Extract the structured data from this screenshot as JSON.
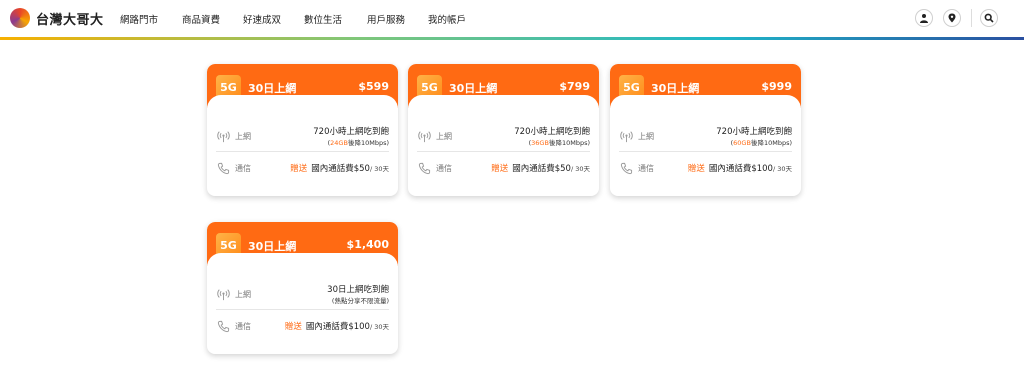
{
  "brand": {
    "name": "台灣大哥大"
  },
  "nav": {
    "items": [
      "網路門市",
      "商品資費",
      "好速成双",
      "數位生活",
      "用戶服務",
      "我的帳戶"
    ]
  },
  "header_icons": [
    "user-icon",
    "location-pin-icon",
    "search-icon"
  ],
  "colors": {
    "accent": "#ff6a13",
    "badge": "#ff9a2e"
  },
  "plans": [
    {
      "badge": "5G",
      "title": "30日上網",
      "price": "$599",
      "data_label": "上網",
      "data_main": "720小時上網吃到飽",
      "data_sub_prefix": "(",
      "data_sub_highlight": "24GB",
      "data_sub_suffix": "後降10Mbps)",
      "call_label": "通信",
      "call_gift": "贈送",
      "call_text": "國內通話費$50",
      "call_per": "/ 30天"
    },
    {
      "badge": "5G",
      "title": "30日上網",
      "price": "$799",
      "data_label": "上網",
      "data_main": "720小時上網吃到飽",
      "data_sub_prefix": "(",
      "data_sub_highlight": "36GB",
      "data_sub_suffix": "後降10Mbps)",
      "call_label": "通信",
      "call_gift": "贈送",
      "call_text": "國內通話費$50",
      "call_per": "/ 30天"
    },
    {
      "badge": "5G",
      "title": "30日上網",
      "price": "$999",
      "data_label": "上網",
      "data_main": "720小時上網吃到飽",
      "data_sub_prefix": "(",
      "data_sub_highlight": "60GB",
      "data_sub_suffix": "後降10Mbps)",
      "call_label": "通信",
      "call_gift": "贈送",
      "call_text": "國內通話費$100",
      "call_per": "/ 30天"
    },
    {
      "badge": "5G",
      "title": "30日上網",
      "price": "$1,400",
      "data_label": "上網",
      "data_main": "30日上網吃到飽",
      "data_sub_prefix": "(熱點分享不限流量)",
      "data_sub_highlight": "",
      "data_sub_suffix": "",
      "call_label": "通信",
      "call_gift": "贈送",
      "call_text": "國內通話費$100",
      "call_per": "/ 30天"
    }
  ]
}
